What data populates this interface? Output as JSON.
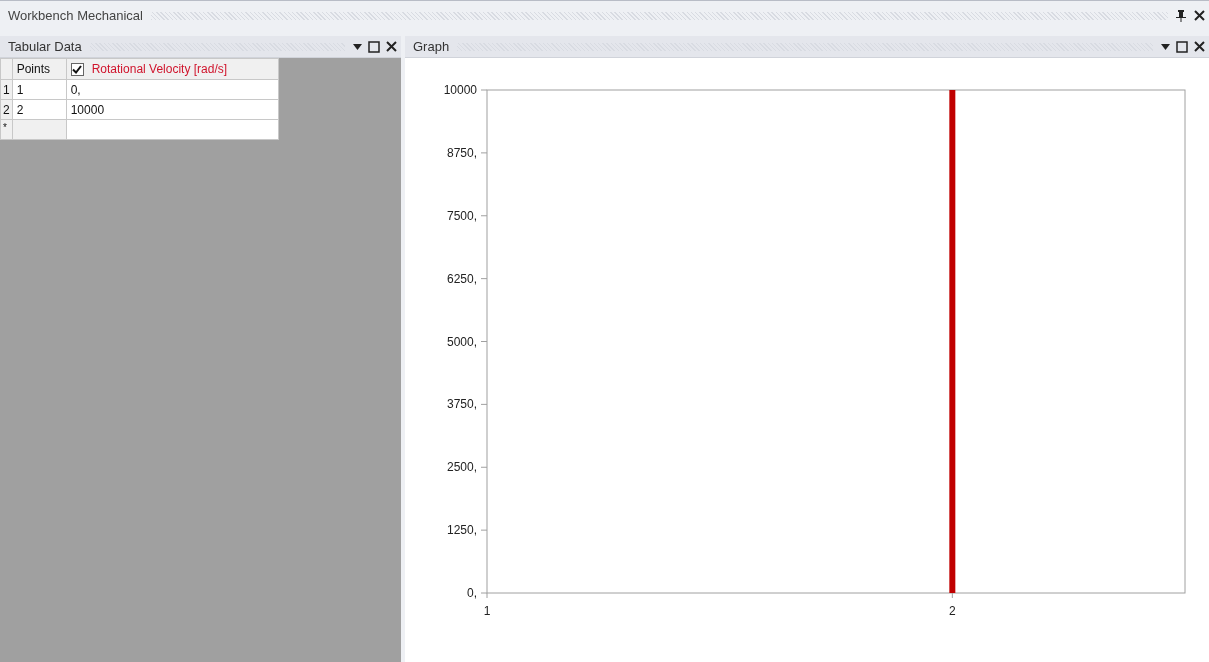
{
  "window": {
    "title": "Workbench Mechanical"
  },
  "tabular_data": {
    "title": "Tabular Data",
    "columns": [
      {
        "label": "Points"
      },
      {
        "label": "Rotational Velocity [rad/s]",
        "checked": true
      }
    ],
    "rows": [
      {
        "index": "1",
        "cells": [
          "1",
          "0,"
        ]
      },
      {
        "index": "2",
        "cells": [
          "2",
          "10000"
        ]
      }
    ],
    "new_row_marker": "*"
  },
  "graph": {
    "title": "Graph",
    "chart_data": {
      "type": "bar",
      "x": [
        2
      ],
      "series": [
        {
          "color": "#c00000",
          "values": [
            10000
          ]
        }
      ],
      "xlim": [
        1,
        2.5
      ],
      "ylim": [
        0,
        10000
      ],
      "xticks": [
        1,
        2
      ],
      "yticks": [
        {
          "value": 0,
          "label": "0,"
        },
        {
          "value": 1250,
          "label": "1250,"
        },
        {
          "value": 2500,
          "label": "2500,"
        },
        {
          "value": 3750,
          "label": "3750,"
        },
        {
          "value": 5000,
          "label": "5000,"
        },
        {
          "value": 6250,
          "label": "6250,"
        },
        {
          "value": 7500,
          "label": "7500,"
        },
        {
          "value": 8750,
          "label": "8750,"
        },
        {
          "value": 10000,
          "label": "10000"
        }
      ]
    }
  }
}
